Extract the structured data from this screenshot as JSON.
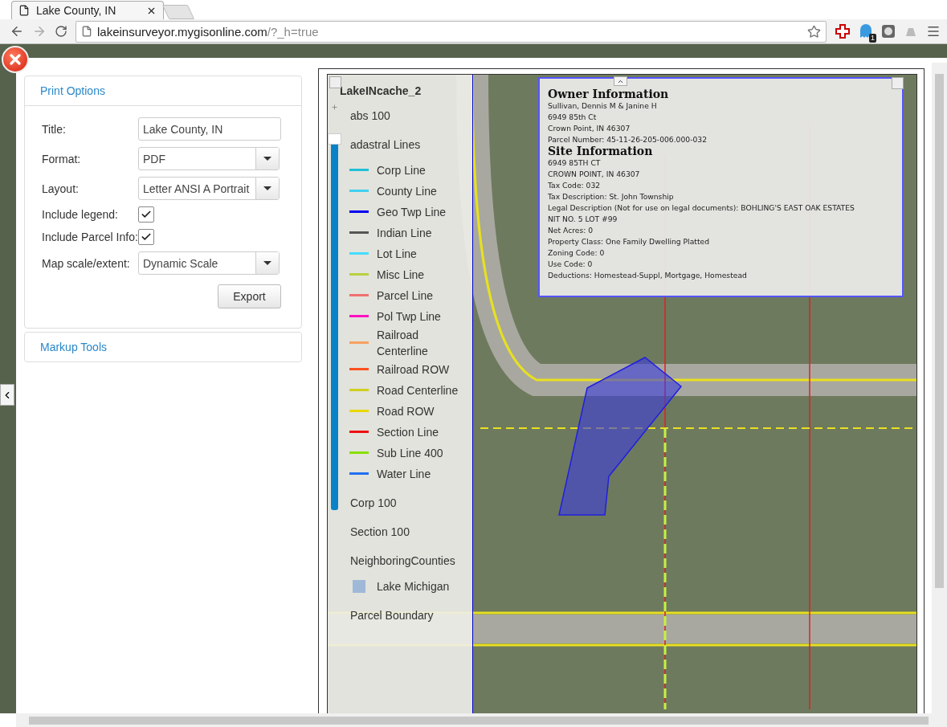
{
  "browser": {
    "tab": {
      "title": "Lake County, IN"
    },
    "url": {
      "host": "lakeinsurveyor.mygisonline.com",
      "path": "/?_h=true"
    },
    "extension_badge": "1"
  },
  "print_options": {
    "header": "Print Options",
    "fields": [
      {
        "kind": "text",
        "label": "Title:",
        "value": "Lake County, IN"
      },
      {
        "kind": "select",
        "label": "Format:",
        "value": "PDF"
      },
      {
        "kind": "select",
        "label": "Layout:",
        "value": "Letter ANSI A Portrait"
      },
      {
        "kind": "checkbox",
        "label": "Include legend:",
        "checked": true
      },
      {
        "kind": "checkbox",
        "label": "Include Parcel Info:",
        "checked": true
      },
      {
        "kind": "select",
        "label": "Map scale/extent:",
        "value": "Dynamic Scale"
      }
    ],
    "button": "Export"
  },
  "markup_tools": {
    "header": "Markup Tools"
  },
  "legend": {
    "title": "LakeINcache_2",
    "zoom_slider": {
      "level": 0.97
    },
    "items": [
      {
        "kind": "group",
        "label": "abs 100"
      },
      {
        "kind": "group",
        "label": "adastral Lines"
      },
      {
        "kind": "line",
        "label": "Corp Line",
        "color": "#22c0d8"
      },
      {
        "kind": "line",
        "label": "County Line",
        "color": "#40d0f0"
      },
      {
        "kind": "line",
        "label": "Geo Twp Line",
        "color": "#0000ee"
      },
      {
        "kind": "line",
        "label": "Indian Line",
        "color": "#555555"
      },
      {
        "kind": "line",
        "label": "Lot Line",
        "color": "#44ddff"
      },
      {
        "kind": "line",
        "label": "Misc Line",
        "color": "#b8d040"
      },
      {
        "kind": "line",
        "label": "Parcel Line",
        "color": "#f07070"
      },
      {
        "kind": "line",
        "label": "Pol Twp Line",
        "color": "#ff10c0"
      },
      {
        "kind": "line",
        "label": "Railroad Centerline",
        "color": "#f8a060"
      },
      {
        "kind": "line",
        "label": "Railroad ROW",
        "color": "#ff5020"
      },
      {
        "kind": "line",
        "label": "Road Centerline",
        "color": "#d0d020"
      },
      {
        "kind": "line",
        "label": "Road ROW",
        "color": "#e8d800"
      },
      {
        "kind": "line",
        "label": "Section Line",
        "color": "#ee1010"
      },
      {
        "kind": "line",
        "label": "Sub Line 400",
        "color": "#88e000"
      },
      {
        "kind": "line",
        "label": "Water Line",
        "color": "#2070f0"
      },
      {
        "kind": "group",
        "label": "Corp 100"
      },
      {
        "kind": "group",
        "label": "Section 100"
      },
      {
        "kind": "group",
        "label": "NeighboringCounties"
      },
      {
        "kind": "swatch",
        "label": "Lake Michigan",
        "color": "#a0b8d8"
      },
      {
        "kind": "group",
        "label": "Parcel Boundary"
      }
    ]
  },
  "parcel_info": {
    "sections": [
      {
        "title": "Owner Information",
        "lines": [
          "Sullivan, Dennis M & Janine H",
          "6949 85th Ct",
          "Crown Point, IN 46307",
          "Parcel Number: 45-11-26-205-006.000-032"
        ]
      },
      {
        "title": "Site Information",
        "lines": [
          "6949 85TH CT",
          "CROWN POINT, IN 46307",
          "Tax Code: 032",
          "Tax Description: St. John Township",
          "Legal Description (Not for use on legal documents): BOHLING'S EAST OAK ESTATES",
          "NIT NO. 5 LOT #99",
          "Net Acres: 0",
          "Property Class: One Family Dwelling Platted",
          "Zoning Code: 0",
          "Use Code: 0",
          "Deductions: Homestead-Suppl, Mortgage, Homestead"
        ]
      }
    ]
  }
}
